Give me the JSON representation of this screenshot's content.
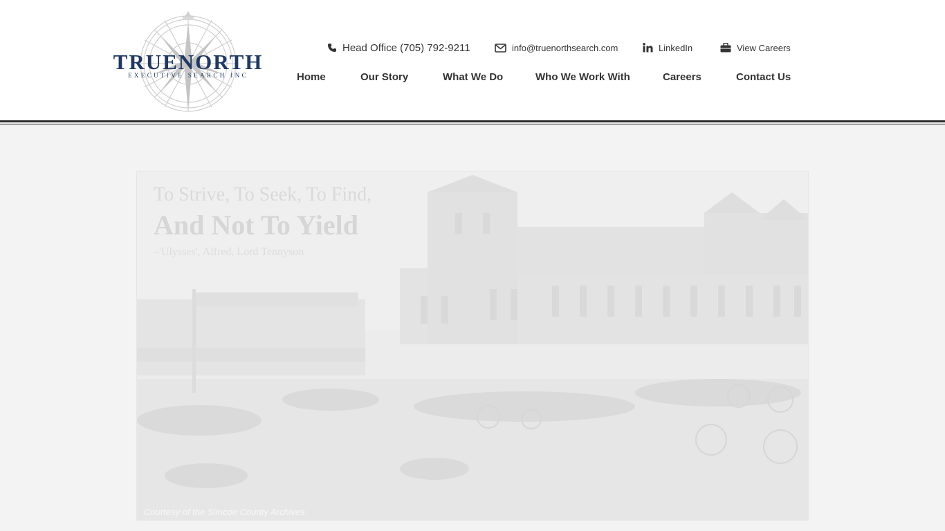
{
  "brand": {
    "name": "TRUENORTH",
    "tagline": "EXECUTIVE SEARCH INC",
    "primary_color": "#1f3864",
    "compass_color": "#c9c9c9"
  },
  "contact": {
    "phone": {
      "icon": "phone-icon",
      "text": "Head Office (705) 792-9211"
    },
    "email": {
      "icon": "envelope-icon",
      "text": "info@truenorthsearch.com"
    },
    "linkedin": {
      "icon": "linkedin-icon",
      "text": "LinkedIn"
    },
    "careers": {
      "icon": "briefcase-icon",
      "text": "View Careers"
    }
  },
  "nav": {
    "items": [
      {
        "label": "Home"
      },
      {
        "label": "Our Story"
      },
      {
        "label": "What We Do"
      },
      {
        "label": "Who We Work With"
      },
      {
        "label": "Careers"
      },
      {
        "label": "Contact Us"
      }
    ]
  },
  "hero": {
    "quote_line1": "To Strive, To Seek, To Find,",
    "quote_line2": "And Not To Yield",
    "attribution": "–'Ulysses', Alfred, Lord Tennyson",
    "credit": "Courtesy of the Simcoe County Archives"
  }
}
